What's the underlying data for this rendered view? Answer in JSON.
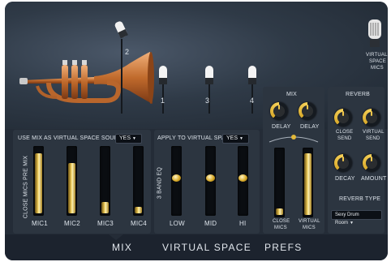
{
  "mics": {
    "labels": [
      "2",
      "1",
      "3",
      "4"
    ],
    "virtual_space_lines": [
      "VIRTUAL",
      "SPACE",
      "MICS"
    ]
  },
  "left_panel": {
    "source_label": "USE MIX AS VIRTUAL SPACE SOURCE",
    "source_value": "YES",
    "section_label": "CLOSE MICS PRE MIX",
    "fader_labels": [
      "MIC1",
      "MIC2",
      "MIC3",
      "MIC4"
    ],
    "fader_levels": [
      0.92,
      0.78,
      0.18,
      0.06
    ]
  },
  "eq_panel": {
    "apply_label": "APPLY TO VIRTUAL SPACE",
    "apply_value": "YES",
    "section_label": "3 BAND EQ",
    "band_labels": [
      "LOW",
      "MID",
      "HI"
    ],
    "band_levels": [
      0.55,
      0.55,
      0.55
    ]
  },
  "mix_panel": {
    "title": "MIX",
    "knob_labels": [
      "DELAY",
      "DELAY"
    ],
    "fader_labels": [
      [
        "CLOSE",
        "MICS"
      ],
      [
        "VIRTUAL",
        "MICS"
      ]
    ],
    "fader_levels": [
      0.08,
      0.95
    ]
  },
  "reverb_panel": {
    "title": "REVERB",
    "send_labels": [
      [
        "CLOSE",
        "SEND"
      ],
      [
        "VIRTUAL",
        "SEND"
      ]
    ],
    "knob_labels": [
      "DECAY",
      "AMOUNT"
    ],
    "type_label": "REVERB TYPE",
    "type_value": "Sexy Drum Room"
  },
  "tabs": [
    "MIX",
    "VIRTUAL SPACE",
    "PREFS"
  ],
  "active_tab": "MIX",
  "colors": {
    "background": "#1d2531",
    "gold": "#e8bd3c",
    "text": "#dde3ea",
    "brass": "#c77a3a"
  }
}
